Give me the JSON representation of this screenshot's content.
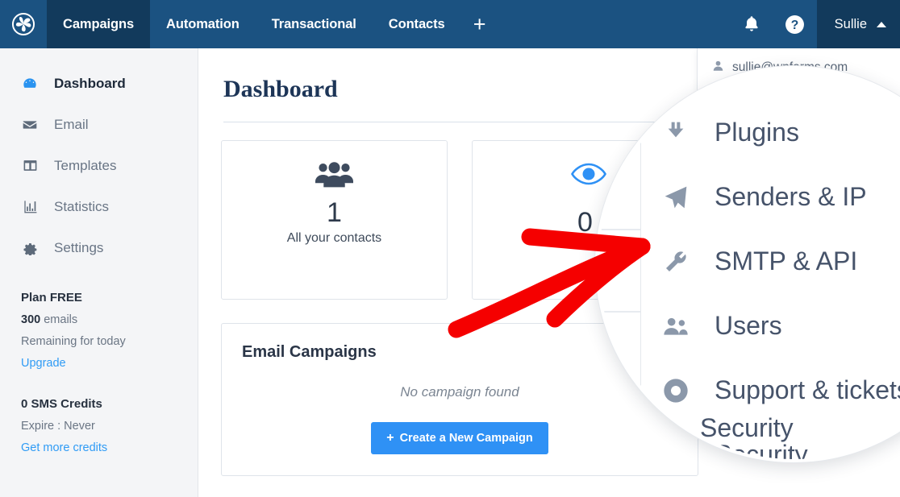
{
  "header": {
    "logo_icon": "brevo-pinwheel-logo",
    "tabs": [
      {
        "label": "Campaigns",
        "active": true
      },
      {
        "label": "Automation",
        "active": false
      },
      {
        "label": "Transactional",
        "active": false
      },
      {
        "label": "Contacts",
        "active": false
      }
    ],
    "add_label": "+",
    "bell_icon": "bell-icon",
    "help_icon": "question-circle-icon",
    "user_name": "Sullie",
    "user_caret": "caret-up-icon"
  },
  "sidebar": {
    "items": [
      {
        "label": "Dashboard",
        "icon": "dashboard-gauge-icon",
        "active": true
      },
      {
        "label": "Email",
        "icon": "envelope-icon",
        "active": false
      },
      {
        "label": "Templates",
        "icon": "layout-columns-icon",
        "active": false
      },
      {
        "label": "Statistics",
        "icon": "bar-chart-icon",
        "active": false
      },
      {
        "label": "Settings",
        "icon": "gear-icon",
        "active": false
      }
    ],
    "plan": {
      "title": "Plan FREE",
      "emails_count": "300",
      "emails_word": "emails",
      "remaining": "Remaining for today",
      "upgrade_link": "Upgrade"
    },
    "sms": {
      "title": "0 SMS Credits",
      "expire": "Expire : Never",
      "credits_link": "Get more credits"
    }
  },
  "main": {
    "page_title": "Dashboard",
    "cards": [
      {
        "icon": "users-group-icon",
        "value": "1",
        "label": "All your contacts"
      },
      {
        "icon": "eye-icon",
        "value": "0",
        "label": ""
      }
    ],
    "panel": {
      "title": "Email Campaigns",
      "empty_text": "No campaign found",
      "cta_plus": "+",
      "cta_label": "Create a New Campaign"
    }
  },
  "dropdown": {
    "account_email": "sullie@wpforms.com",
    "account_icon": "user-icon",
    "items": [
      {
        "label": "Plugins",
        "icon": "plug-icon"
      },
      {
        "label": "Senders & IP",
        "icon": "paper-plane-icon"
      },
      {
        "label": "SMTP & API",
        "icon": "wrench-icon"
      },
      {
        "label": "Users",
        "icon": "users-icon"
      },
      {
        "label": "Support & tickets",
        "icon": "lifebuoy-icon"
      },
      {
        "label": "Security",
        "icon": "shield-icon"
      }
    ]
  },
  "annotation": {
    "arrow_icon": "red-arrow-annotation",
    "arrow_color": "#f50000",
    "points_to": "SMTP & API"
  },
  "colors": {
    "nav_bg": "#1b5281",
    "nav_active_bg": "#123a5c",
    "sidebar_bg": "#f4f5f7",
    "accent_blue": "#2f91f5",
    "text_dark": "#2a3547",
    "annotation_red": "#f50000"
  }
}
